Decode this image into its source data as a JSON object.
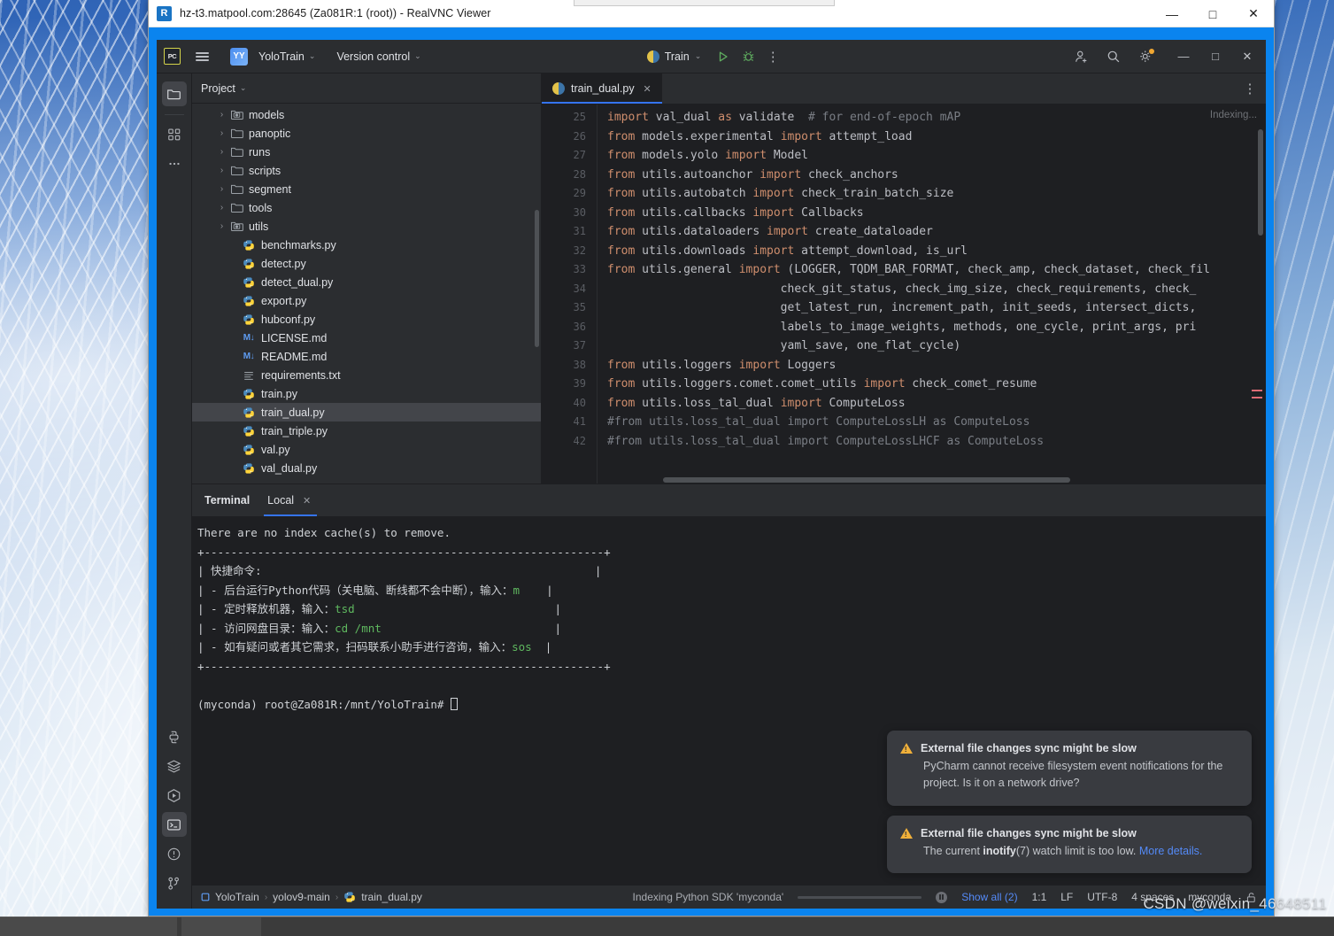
{
  "vnc": {
    "title": "hz-t3.matpool.com:28645 (Za081R:1 (root)) - RealVNC Viewer",
    "logo_text": "R",
    "minimize": "—",
    "maximize": "□",
    "close": "✕"
  },
  "toolbar": {
    "logo_text": "PC",
    "project_badge": "YY",
    "project_name": "YoloTrain",
    "version_control": "Version control",
    "run_config": "Train",
    "chevron": "⌄",
    "more_icon": "⋮",
    "minimize": "—",
    "maximize": "□",
    "close": "✕"
  },
  "project_panel": {
    "title": "Project",
    "chevron": "⌄",
    "tree": [
      {
        "label": "models",
        "icon": "module-folder-icon",
        "arrow": "›",
        "indent": 1,
        "selected": false
      },
      {
        "label": "panoptic",
        "icon": "folder-icon",
        "arrow": "›",
        "indent": 1,
        "selected": false
      },
      {
        "label": "runs",
        "icon": "folder-icon",
        "arrow": "›",
        "indent": 1,
        "selected": false
      },
      {
        "label": "scripts",
        "icon": "folder-icon",
        "arrow": "›",
        "indent": 1,
        "selected": false
      },
      {
        "label": "segment",
        "icon": "folder-icon",
        "arrow": "›",
        "indent": 1,
        "selected": false
      },
      {
        "label": "tools",
        "icon": "folder-icon",
        "arrow": "›",
        "indent": 1,
        "selected": false
      },
      {
        "label": "utils",
        "icon": "module-folder-icon",
        "arrow": "›",
        "indent": 1,
        "selected": false
      },
      {
        "label": "benchmarks.py",
        "icon": "python-file-icon",
        "arrow": "",
        "indent": 2,
        "selected": false
      },
      {
        "label": "detect.py",
        "icon": "python-file-icon",
        "arrow": "",
        "indent": 2,
        "selected": false
      },
      {
        "label": "detect_dual.py",
        "icon": "python-file-icon",
        "arrow": "",
        "indent": 2,
        "selected": false
      },
      {
        "label": "export.py",
        "icon": "python-file-icon",
        "arrow": "",
        "indent": 2,
        "selected": false
      },
      {
        "label": "hubconf.py",
        "icon": "python-file-icon",
        "arrow": "",
        "indent": 2,
        "selected": false
      },
      {
        "label": "LICENSE.md",
        "icon": "markdown-file-icon",
        "arrow": "",
        "indent": 2,
        "selected": false
      },
      {
        "label": "README.md",
        "icon": "markdown-file-icon",
        "arrow": "",
        "indent": 2,
        "selected": false
      },
      {
        "label": "requirements.txt",
        "icon": "text-file-icon",
        "arrow": "",
        "indent": 2,
        "selected": false
      },
      {
        "label": "train.py",
        "icon": "python-file-icon",
        "arrow": "",
        "indent": 2,
        "selected": false
      },
      {
        "label": "train_dual.py",
        "icon": "python-file-icon",
        "arrow": "",
        "indent": 2,
        "selected": true
      },
      {
        "label": "train_triple.py",
        "icon": "python-file-icon",
        "arrow": "",
        "indent": 2,
        "selected": false
      },
      {
        "label": "val.py",
        "icon": "python-file-icon",
        "arrow": "",
        "indent": 2,
        "selected": false
      },
      {
        "label": "val_dual.py",
        "icon": "python-file-icon",
        "arrow": "",
        "indent": 2,
        "selected": false
      }
    ]
  },
  "editor": {
    "tab_name": "train_dual.py",
    "tab_close": "✕",
    "more_icon": "⋮",
    "indexing_badge": "Indexing...",
    "first_line_number": 25,
    "lines": [
      {
        "n": 25,
        "segments": [
          {
            "t": "import",
            "c": "kw"
          },
          {
            "t": " val_dual ",
            "c": "id"
          },
          {
            "t": "as",
            "c": "kw"
          },
          {
            "t": " validate  ",
            "c": "id"
          },
          {
            "t": "# for end-of-epoch mAP",
            "c": "cm"
          }
        ]
      },
      {
        "n": 26,
        "segments": [
          {
            "t": "from",
            "c": "kw"
          },
          {
            "t": " models.experimental ",
            "c": "id"
          },
          {
            "t": "import",
            "c": "kw"
          },
          {
            "t": " attempt_load",
            "c": "id"
          }
        ]
      },
      {
        "n": 27,
        "segments": [
          {
            "t": "from",
            "c": "kw"
          },
          {
            "t": " models.yolo ",
            "c": "id"
          },
          {
            "t": "import",
            "c": "kw"
          },
          {
            "t": " Model",
            "c": "id"
          }
        ]
      },
      {
        "n": 28,
        "segments": [
          {
            "t": "from",
            "c": "kw"
          },
          {
            "t": " utils.autoanchor ",
            "c": "id"
          },
          {
            "t": "import",
            "c": "kw"
          },
          {
            "t": " check_anchors",
            "c": "id"
          }
        ]
      },
      {
        "n": 29,
        "segments": [
          {
            "t": "from",
            "c": "kw"
          },
          {
            "t": " utils.autobatch ",
            "c": "id"
          },
          {
            "t": "import",
            "c": "kw"
          },
          {
            "t": " check_train_batch_size",
            "c": "id"
          }
        ]
      },
      {
        "n": 30,
        "segments": [
          {
            "t": "from",
            "c": "kw"
          },
          {
            "t": " utils.callbacks ",
            "c": "id"
          },
          {
            "t": "import",
            "c": "kw"
          },
          {
            "t": " Callbacks",
            "c": "id"
          }
        ]
      },
      {
        "n": 31,
        "segments": [
          {
            "t": "from",
            "c": "kw"
          },
          {
            "t": " utils.dataloaders ",
            "c": "id"
          },
          {
            "t": "import",
            "c": "kw"
          },
          {
            "t": " create_dataloader",
            "c": "id"
          }
        ]
      },
      {
        "n": 32,
        "segments": [
          {
            "t": "from",
            "c": "kw"
          },
          {
            "t": " utils.downloads ",
            "c": "id"
          },
          {
            "t": "import",
            "c": "kw"
          },
          {
            "t": " attempt_download, is_url",
            "c": "id"
          }
        ]
      },
      {
        "n": 33,
        "segments": [
          {
            "t": "from",
            "c": "kw"
          },
          {
            "t": " utils.general ",
            "c": "id"
          },
          {
            "t": "import",
            "c": "kw"
          },
          {
            "t": " (LOGGER, TQDM_BAR_FORMAT, check_amp, check_dataset, check_fil",
            "c": "id"
          }
        ]
      },
      {
        "n": 34,
        "segments": [
          {
            "t": "                         check_git_status, check_img_size, check_requirements, check_",
            "c": "id"
          }
        ]
      },
      {
        "n": 35,
        "segments": [
          {
            "t": "                         get_latest_run, increment_path, init_seeds, intersect_dicts,",
            "c": "id"
          }
        ]
      },
      {
        "n": 36,
        "segments": [
          {
            "t": "                         labels_to_image_weights, methods, one_cycle, print_args, pri",
            "c": "id"
          }
        ]
      },
      {
        "n": 37,
        "segments": [
          {
            "t": "                         yaml_save, one_flat_cycle)",
            "c": "id"
          }
        ]
      },
      {
        "n": 38,
        "segments": [
          {
            "t": "from",
            "c": "kw"
          },
          {
            "t": " utils.loggers ",
            "c": "id"
          },
          {
            "t": "import",
            "c": "kw"
          },
          {
            "t": " Loggers",
            "c": "id"
          }
        ]
      },
      {
        "n": 39,
        "segments": [
          {
            "t": "from",
            "c": "kw"
          },
          {
            "t": " utils.loggers.comet.comet_utils ",
            "c": "id"
          },
          {
            "t": "import",
            "c": "kw"
          },
          {
            "t": " check_comet_resume",
            "c": "id"
          }
        ]
      },
      {
        "n": 40,
        "segments": [
          {
            "t": "from",
            "c": "kw"
          },
          {
            "t": " utils.loss_tal_dual ",
            "c": "id"
          },
          {
            "t": "import",
            "c": "kw"
          },
          {
            "t": " ComputeLoss",
            "c": "id"
          }
        ]
      },
      {
        "n": 41,
        "segments": [
          {
            "t": "#from utils.loss_tal_dual import ComputeLossLH as ComputeLoss",
            "c": "cm"
          }
        ]
      },
      {
        "n": 42,
        "segments": [
          {
            "t": "#from utils.loss_tal_dual import ComputeLossLHCF as ComputeLoss",
            "c": "cm"
          }
        ]
      }
    ]
  },
  "terminal": {
    "title": "Terminal",
    "tab_label": "Local",
    "tab_close": "✕",
    "lines": [
      {
        "segments": [
          {
            "t": "There are no index cache(s) to remove.",
            "c": ""
          }
        ]
      },
      {
        "segments": [
          {
            "t": "+------------------------------------------------------------+",
            "c": ""
          }
        ]
      },
      {
        "segments": [
          {
            "t": "| 快捷命令:                                                  |",
            "c": ""
          }
        ]
      },
      {
        "segments": [
          {
            "t": "| - 后台运行Python代码（关电脑、断线都不会中断），输入：",
            "c": ""
          },
          {
            "t": "m",
            "c": "t-green"
          },
          {
            "t": "    |",
            "c": ""
          }
        ]
      },
      {
        "segments": [
          {
            "t": "| - 定时释放机器，输入：",
            "c": ""
          },
          {
            "t": "tsd",
            "c": "t-green"
          },
          {
            "t": "                              |",
            "c": ""
          }
        ]
      },
      {
        "segments": [
          {
            "t": "| - 访问网盘目录：输入：",
            "c": ""
          },
          {
            "t": "cd /mnt",
            "c": "t-green"
          },
          {
            "t": "                          |",
            "c": ""
          }
        ]
      },
      {
        "segments": [
          {
            "t": "| - 如有疑问或者其它需求，扫码联系小助手进行咨询，输入：",
            "c": ""
          },
          {
            "t": "sos",
            "c": "t-green"
          },
          {
            "t": "  |",
            "c": ""
          }
        ]
      },
      {
        "segments": [
          {
            "t": "+------------------------------------------------------------+",
            "c": ""
          }
        ]
      },
      {
        "segments": [
          {
            "t": "",
            "c": ""
          }
        ]
      },
      {
        "segments": [
          {
            "t": "(myconda) root@Za081R:/mnt/YoloTrain# ",
            "c": ""
          },
          {
            "t": "CURSOR",
            "c": "cursor"
          }
        ]
      }
    ]
  },
  "notifications": [
    {
      "title": "External file changes sync might be slow",
      "body_parts": [
        {
          "t": "PyCharm cannot receive filesystem event notifications for the project. Is it on a network drive?",
          "c": ""
        }
      ]
    },
    {
      "title": "External file changes sync might be slow",
      "body_parts": [
        {
          "t": "The current ",
          "c": ""
        },
        {
          "t": "inotify",
          "c": "bold"
        },
        {
          "t": "(7) watch limit is too low. ",
          "c": ""
        },
        {
          "t": "More details.",
          "c": "lnk"
        }
      ]
    }
  ],
  "status_bar": {
    "breadcrumbs": [
      "YoloTrain",
      "yolov9-main",
      "train_dual.py"
    ],
    "crumb_sep": "›",
    "indexing": "Indexing Python SDK 'myconda'",
    "show_all": "Show all (2)",
    "caret": "1:1",
    "line_sep": "LF",
    "encoding": "UTF-8",
    "indent": "4 spaces",
    "interpreter": "myconda"
  },
  "left_rail": {
    "top": [
      {
        "name": "project-tool-icon",
        "active": true
      },
      {
        "name": "structure-tool-icon",
        "active": false
      },
      {
        "name": "more-tools-icon",
        "active": false
      }
    ],
    "bottom": [
      {
        "name": "python-packages-icon",
        "active": false
      },
      {
        "name": "services-icon",
        "active": false
      },
      {
        "name": "run-tool-icon",
        "active": false
      },
      {
        "name": "terminal-tool-icon",
        "active": true
      },
      {
        "name": "problems-tool-icon",
        "active": false
      },
      {
        "name": "version-control-tool-icon",
        "active": false
      }
    ]
  },
  "watermark": "CSDN @weixin_46648511"
}
